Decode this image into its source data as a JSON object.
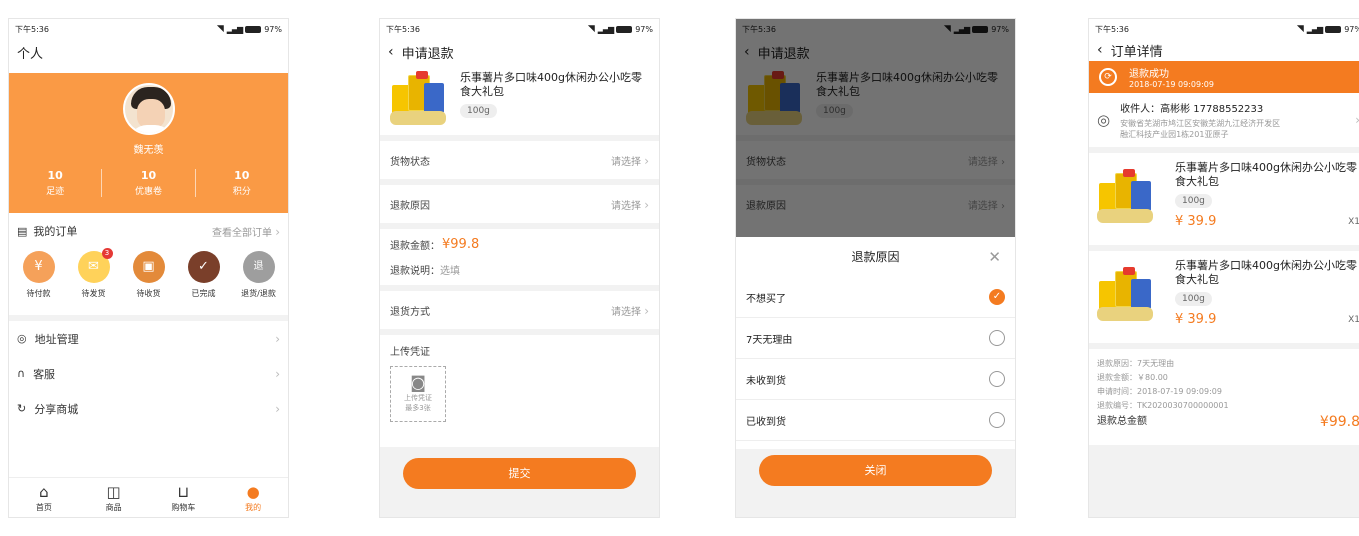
{
  "status": {
    "time": "下午5:36",
    "battery": "97%"
  },
  "screen1": {
    "title": "个人",
    "user_name": "魏无羡",
    "stats": [
      {
        "num": "10",
        "label": "足迹"
      },
      {
        "num": "10",
        "label": "优惠卷"
      },
      {
        "num": "10",
        "label": "积分"
      }
    ],
    "orders_title": "我的订单",
    "orders_view_all": "查看全部订单",
    "order_icons": [
      {
        "label": "待付款",
        "color": "#f5a15a",
        "glyph": "¥"
      },
      {
        "label": "待发货",
        "color": "#ffd25a",
        "glyph": "✉",
        "badge": "3"
      },
      {
        "label": "待收货",
        "color": "#e38a3a",
        "glyph": "▣"
      },
      {
        "label": "已完成",
        "color": "#7a3f2a",
        "glyph": "✓"
      },
      {
        "label": "退货/退款",
        "color": "#9e9e9e",
        "glyph": "退"
      }
    ],
    "menu": [
      "地址管理",
      "客服",
      "分享商城"
    ],
    "tabs": [
      "首页",
      "商品",
      "购物车",
      "我的"
    ]
  },
  "screen2": {
    "title": "申请退款",
    "product_title": "乐事薯片多口味400g休闲办公小吃零食大礼包",
    "spec": "100g",
    "goods_status_label": "货物状态",
    "reason_label": "退款原因",
    "select_placeholder": "请选择",
    "amount_label": "退款金额：",
    "amount": "¥99.8",
    "note_label": "退款说明：",
    "note_placeholder": "选填",
    "return_method_label": "退货方式",
    "upload_title": "上传凭证",
    "upload_hint1": "上传凭证",
    "upload_hint2": "最多3张",
    "submit": "提交"
  },
  "screen3": {
    "sheet_title": "退款原因",
    "options": [
      "不想买了",
      "7天无理由",
      "未收到货",
      "已收到货"
    ],
    "close": "关闭"
  },
  "screen4": {
    "title": "订单详情",
    "success_title": "退款成功",
    "success_time": "2018-07-19 09:09:09",
    "receiver": "收件人：高彬彬    17788552233",
    "address1": "安徽省芜湖市鸠江区安徽芜湖九江经济开发区",
    "address2": "融汇科技产业园1栋201亚原子",
    "items": [
      {
        "title": "乐事薯片多口味400g休闲办公小吃零食大礼包",
        "spec": "100g",
        "price": "¥ 39.9",
        "qty": "X1"
      },
      {
        "title": "乐事薯片多口味400g休闲办公小吃零食大礼包",
        "spec": "100g",
        "price": "¥ 39.9",
        "qty": "X1"
      }
    ],
    "details": [
      "退款原因：7天无理由",
      "退款金额：￥80.00",
      "申请时间：2018-07-19 09:09:09",
      "退款编号：TK2020030700000001"
    ],
    "total_label": "退款总金额",
    "total": "¥99.8"
  },
  "colors": {
    "accent": "#f47b20",
    "profile_bg": "#fa9a45"
  }
}
